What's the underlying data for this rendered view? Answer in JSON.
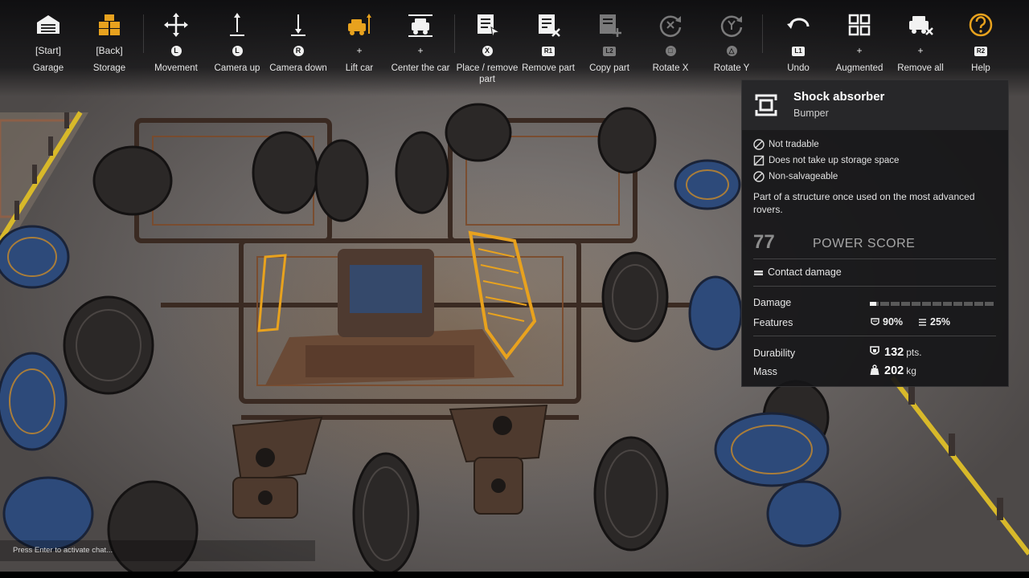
{
  "toolbar": {
    "items": [
      {
        "icon": "garage-icon",
        "key": "[Start]",
        "label": "Garage",
        "enabled": true
      },
      {
        "icon": "storage-icon",
        "key": "[Back]",
        "label": "Storage",
        "enabled": true
      },
      {
        "icon": "move-cross-icon",
        "key": "L",
        "label": "Movement",
        "enabled": true
      },
      {
        "icon": "camera-up-icon",
        "key": "L",
        "label": "Camera up",
        "enabled": true
      },
      {
        "icon": "camera-down-icon",
        "key": "R",
        "label": "Camera down",
        "enabled": true
      },
      {
        "icon": "lift-car-icon",
        "key": "+",
        "label": "Lift car",
        "enabled": true
      },
      {
        "icon": "center-car-icon",
        "key": "+",
        "label": "Center the car",
        "enabled": true
      },
      {
        "icon": "place-part-icon",
        "key": "X",
        "label": "Place / remove part",
        "enabled": true
      },
      {
        "icon": "remove-part-icon",
        "key": "R1",
        "label": "Remove part",
        "enabled": true
      },
      {
        "icon": "copy-part-icon",
        "key": "L2",
        "label": "Copy part",
        "enabled": false
      },
      {
        "icon": "rotate-x-icon",
        "key": "□",
        "label": "Rotate X",
        "enabled": false
      },
      {
        "icon": "rotate-y-icon",
        "key": "△",
        "label": "Rotate Y",
        "enabled": false
      },
      {
        "icon": "undo-icon",
        "key": "L1",
        "label": "Undo",
        "enabled": true
      },
      {
        "icon": "augmented-icon",
        "key": "+",
        "label": "Augmented",
        "enabled": true
      },
      {
        "icon": "remove-all-icon",
        "key": "+",
        "label": "Remove all",
        "enabled": true
      },
      {
        "icon": "help-icon",
        "key": "R2",
        "label": "Help",
        "enabled": true
      }
    ]
  },
  "part": {
    "name": "Shock absorber",
    "type": "Bumper",
    "flags": [
      "Not tradable",
      "Does not take up storage space",
      "Non-salvageable"
    ],
    "description": "Part of a structure once used on the most advanced rovers.",
    "power_score": "77",
    "power_score_label": "POWER SCORE",
    "damage_type": "Contact damage",
    "damage_label": "Damage",
    "damage_fraction": 0.05,
    "features_label": "Features",
    "feature_1": "90%",
    "feature_2": "25%",
    "durability_label": "Durability",
    "durability_value": "132",
    "durability_unit": "pts.",
    "mass_label": "Mass",
    "mass_value": "202",
    "mass_unit": "kg"
  },
  "chat": {
    "hint": "Press Enter to activate chat..."
  },
  "colors": {
    "accent_orange": "#e8a21e",
    "stripe_yellow": "#d8b92a"
  }
}
